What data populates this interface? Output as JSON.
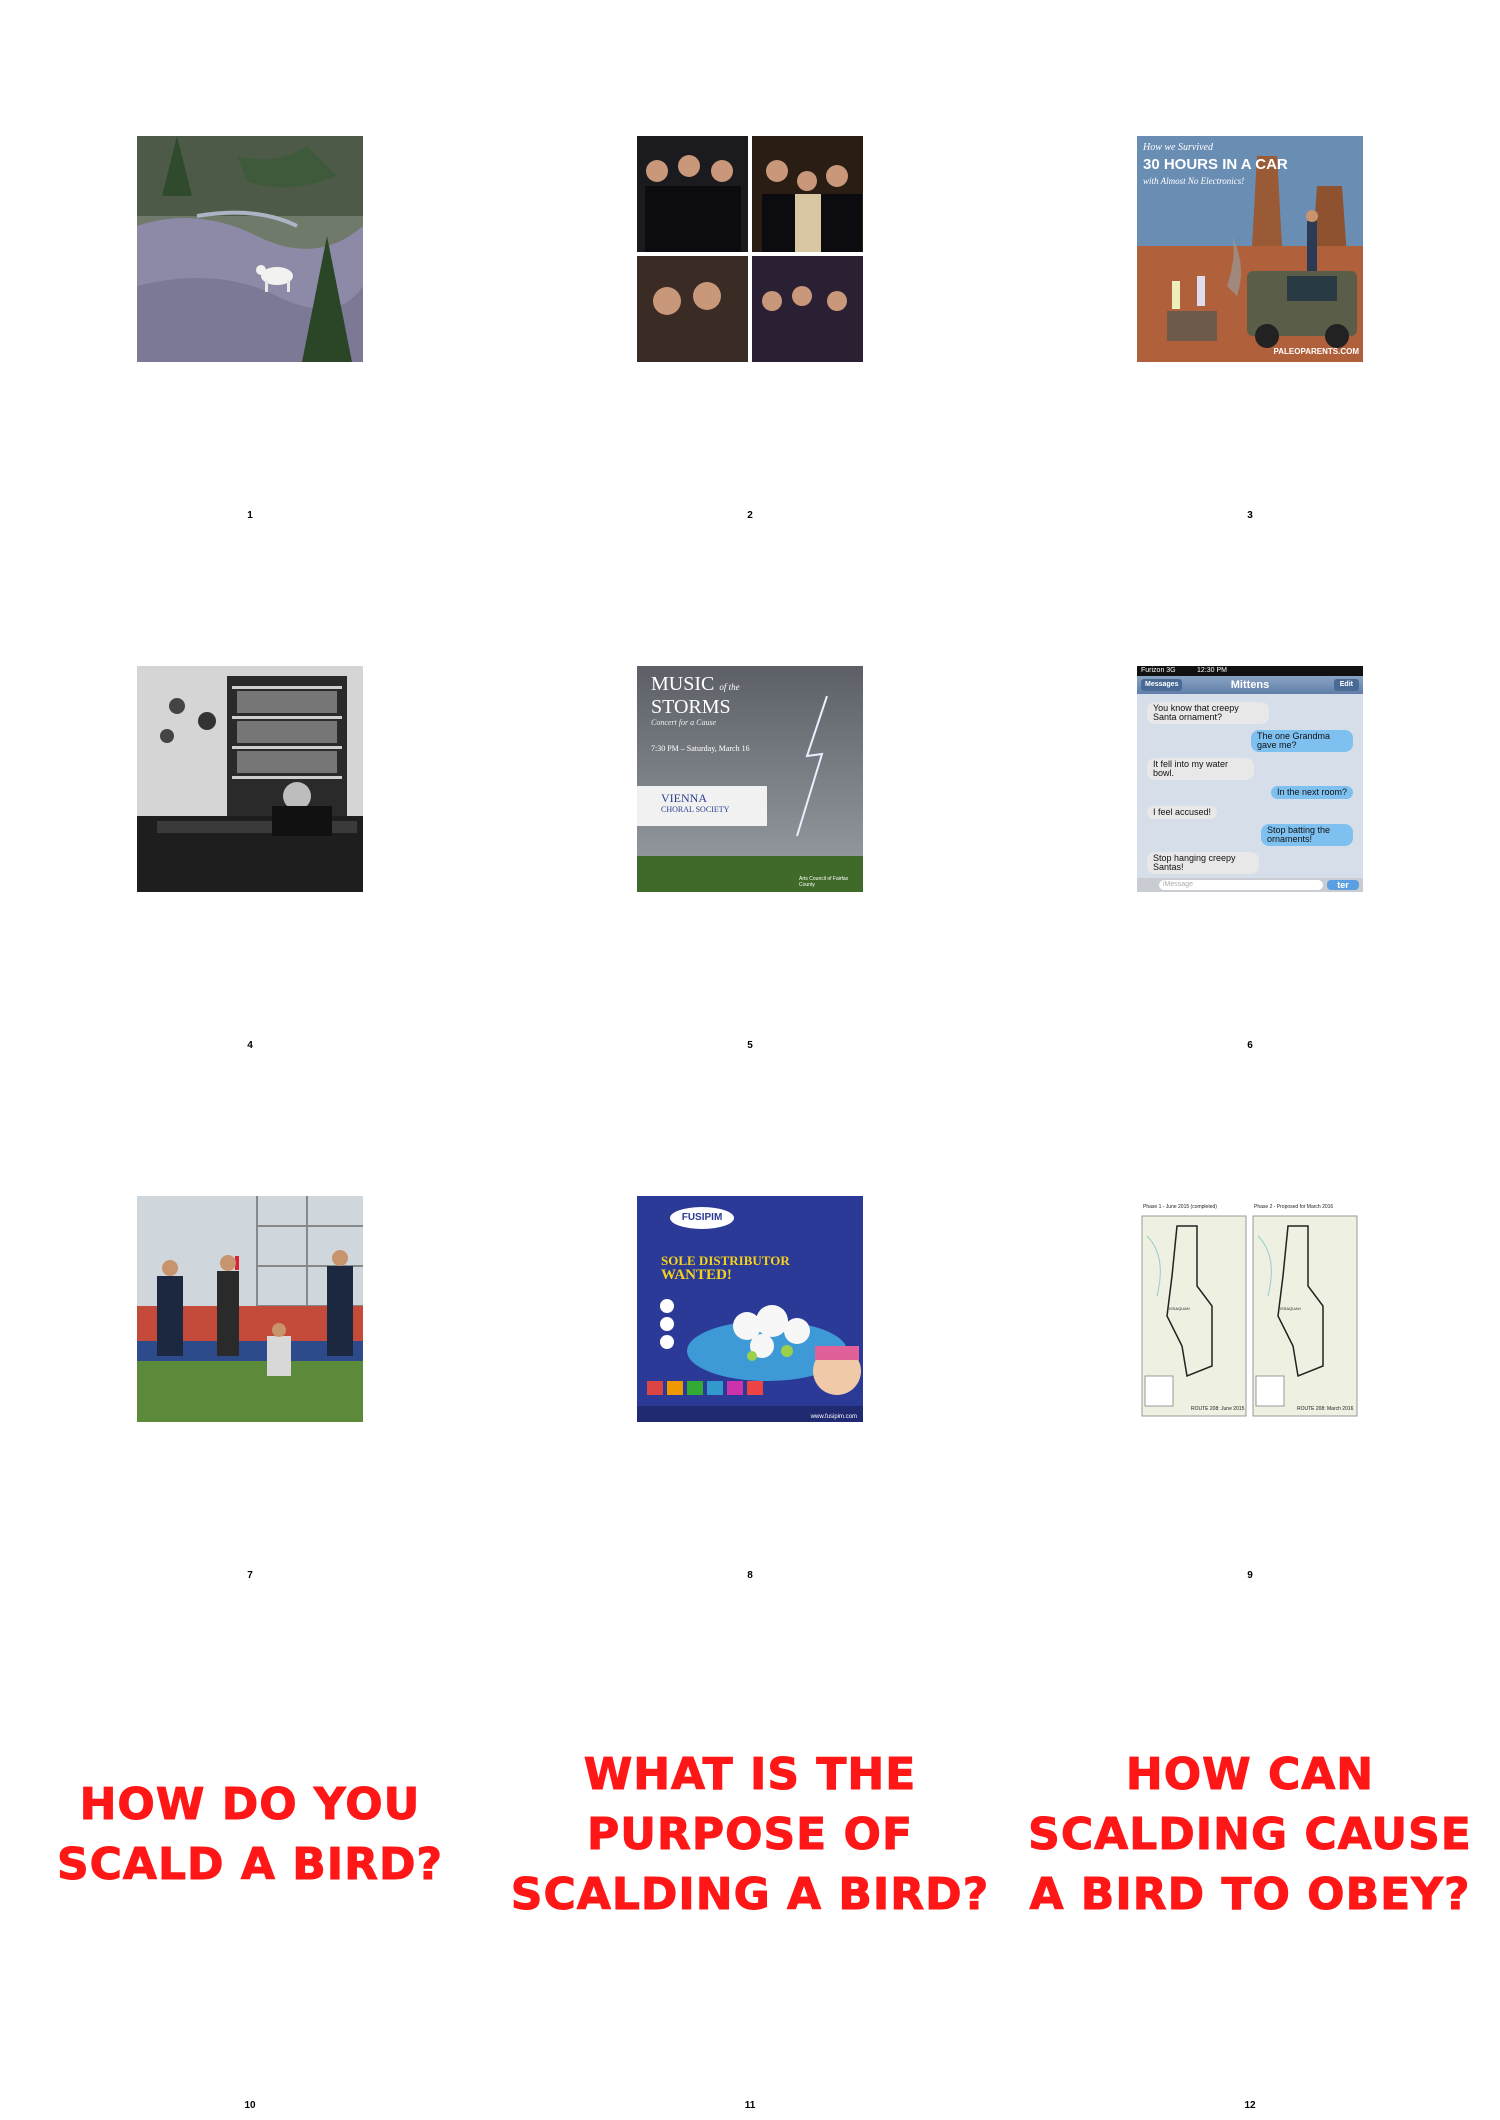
{
  "cells": [
    {
      "number": "1"
    },
    {
      "number": "2"
    },
    {
      "number": "3",
      "overlay_lines": [
        "How we Survived",
        "30 HOURS IN A CAR",
        "with Almost No Electronics!"
      ],
      "credit": "PALEOPARENTS.COM"
    },
    {
      "number": "4"
    },
    {
      "number": "5",
      "title_a": "MUSIC",
      "title_b": "of the",
      "title_c": "STORMS",
      "subtitle": "Concert for a Cause",
      "date": "7:30 PM – Saturday, March 16",
      "org_a": "VIENNA",
      "org_b": "CHORAL SOCIETY",
      "sponsor": "Arts Council of Fairfax County"
    },
    {
      "number": "6",
      "carrier": "Furizon 3G",
      "time": "12:30 PM",
      "back": "Messages",
      "contact": "Mittens",
      "edit": "Edit",
      "messages": [
        "You know that creepy Santa ornament?",
        "The one Grandma gave me?",
        "It fell into my water bowl.",
        "In the next room?",
        "I feel accused!",
        "Stop batting the ornaments!",
        "Stop hanging creepy Santas!"
      ],
      "input_placeholder": "iMessage",
      "send": "ter"
    },
    {
      "number": "7"
    },
    {
      "number": "8",
      "brand": "FUSIPIM",
      "headline_a": "SOLE DISTRIBUTOR",
      "headline_b": "WANTED!",
      "site": "www.fusipim.com"
    },
    {
      "number": "9",
      "panel_a": "Phase 1 - June 2015 (completed)",
      "panel_b": "Phase 2 - Proposed for March 2016",
      "route_a": "ROUTE 208: June 2015",
      "route_b": "ROUTE 208: March 2016",
      "town": "ISSAQUAH"
    },
    {
      "number": "10",
      "question": "HOW DO YOU SCALD A BIRD?"
    },
    {
      "number": "11",
      "question": "WHAT IS THE PURPOSE OF SCALDING A BIRD?"
    },
    {
      "number": "12",
      "question": "HOW CAN SCALDING CAUSE A BIRD TO OBEY?"
    }
  ],
  "colors": {
    "question": "#ff1717",
    "background": "#ffffff"
  }
}
